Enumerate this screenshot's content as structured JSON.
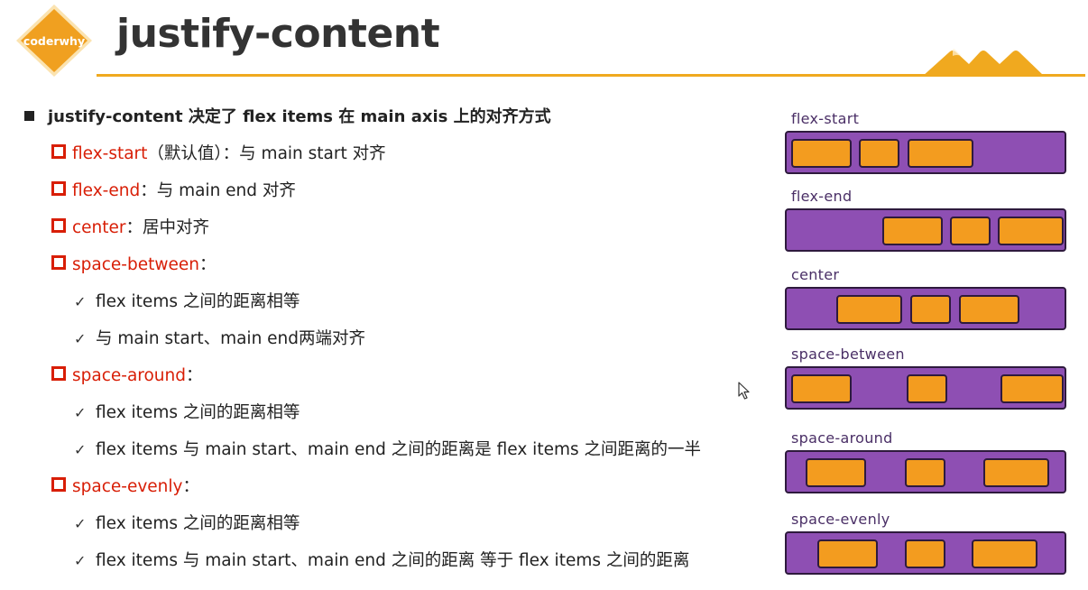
{
  "header": {
    "logo_text": "coderwhy",
    "title": "justify-content"
  },
  "colors": {
    "accent": "#f0a91f",
    "keyword": "#d81e06",
    "container_purple": "#8e4fb3",
    "item_orange": "#f39c1f"
  },
  "bullets": {
    "intro": "justify-content 决定了 flex items 在 main axis 上的对齐方式",
    "flex_start": {
      "keyword": "flex-start",
      "text": "（默认值）：与 main start 对齐"
    },
    "flex_end": {
      "keyword": "flex-end",
      "text": "：与 main end 对齐"
    },
    "center": {
      "keyword": "center",
      "text": "：居中对齐"
    },
    "space_between": {
      "keyword": "space-between",
      "text": "：",
      "points": [
        "flex items 之间的距离相等",
        "与 main start、main end两端对齐"
      ]
    },
    "space_around": {
      "keyword": "space-around",
      "text": "：",
      "points": [
        "flex items 之间的距离相等",
        "flex items 与 main start、main end 之间的距离是 flex items 之间距离的一半"
      ]
    },
    "space_evenly": {
      "keyword": "space-evenly",
      "text": "：",
      "points": [
        "flex items 之间的距离相等",
        "flex items 与 main start、main end 之间的距离 等于 flex items 之间的距离"
      ]
    }
  },
  "diagrams": [
    {
      "label": "flex-start"
    },
    {
      "label": "flex-end"
    },
    {
      "label": "center"
    },
    {
      "label": "space-between"
    },
    {
      "label": "space-around"
    },
    {
      "label": "space-evenly"
    }
  ]
}
